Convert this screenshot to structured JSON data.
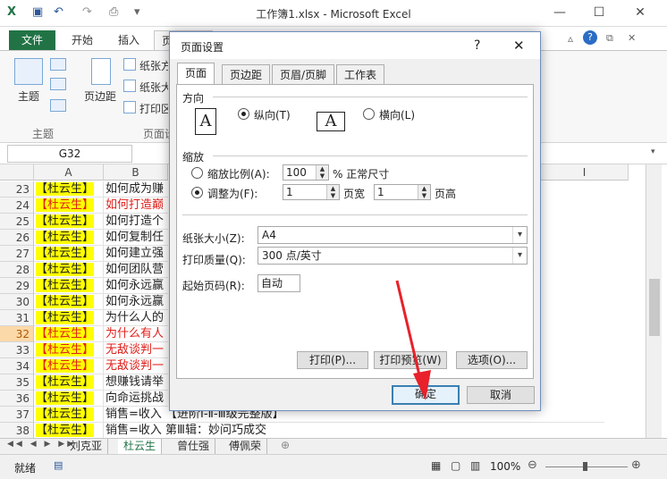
{
  "window": {
    "title": "工作簿1.xlsx - Microsoft Excel",
    "controls": [
      "—",
      "☐",
      "✕"
    ]
  },
  "ribbon": {
    "tabs": [
      "文件",
      "开始",
      "插入",
      "页面布局"
    ],
    "groups": {
      "theme_label": "主题",
      "theme_group": "主题",
      "margins_label": "页边距",
      "orientation_label": "纸张方向",
      "size_label": "纸张大小",
      "print_area_label": "打印区域",
      "page_setup_group": "页面设"
    }
  },
  "formula_bar": {
    "name_box": "G32"
  },
  "grid": {
    "columns": [
      "A",
      "B",
      "I"
    ],
    "rows": [
      {
        "n": "23",
        "a": "【杜云生】",
        "b": "如何成为赚",
        "red": false,
        "sel": false
      },
      {
        "n": "24",
        "a": "【杜云生】",
        "b": "如何打造巅",
        "red": true,
        "sel": false
      },
      {
        "n": "25",
        "a": "【杜云生】",
        "b": "如何打造个",
        "red": false,
        "sel": false
      },
      {
        "n": "26",
        "a": "【杜云生】",
        "b": "如何复制任",
        "red": false,
        "sel": false
      },
      {
        "n": "27",
        "a": "【杜云生】",
        "b": "如何建立强",
        "red": false,
        "sel": false
      },
      {
        "n": "28",
        "a": "【杜云生】",
        "b": "如何团队营",
        "red": false,
        "sel": false
      },
      {
        "n": "29",
        "a": "【杜云生】",
        "b": "如何永远赢",
        "red": false,
        "sel": false
      },
      {
        "n": "30",
        "a": "【杜云生】",
        "b": "如何永远赢",
        "red": false,
        "sel": false
      },
      {
        "n": "31",
        "a": "【杜云生】",
        "b": "为什么人的",
        "red": false,
        "sel": false
      },
      {
        "n": "32",
        "a": "【杜云生】",
        "b": "为什么有人",
        "red": true,
        "sel": true
      },
      {
        "n": "33",
        "a": "【杜云生】",
        "b": "无敌谈判一",
        "red": true,
        "sel": false
      },
      {
        "n": "34",
        "a": "【杜云生】",
        "b": "无敌谈判一",
        "red": true,
        "sel": false
      },
      {
        "n": "35",
        "a": "【杜云生】",
        "b": "想赚钱请举",
        "red": false,
        "sel": false
      },
      {
        "n": "36",
        "a": "【杜云生】",
        "b": "向命运挑战",
        "red": false,
        "sel": false
      },
      {
        "n": "37",
        "a": "【杜云生】",
        "b": "销售=收入 【进阶Ⅰ-Ⅱ-Ⅲ级完整版】",
        "red": false,
        "sel": false
      },
      {
        "n": "38",
        "a": "【杜云生】",
        "b": "销售=收入 第Ⅲ辑：妙问巧成交",
        "red": false,
        "sel": false
      }
    ]
  },
  "sheets": [
    "刘克亚",
    "杜云生",
    "曾仕强",
    "傅佩荣"
  ],
  "status": {
    "ready": "就绪",
    "zoom": "100%"
  },
  "dialog": {
    "title": "页面设置",
    "help": "?",
    "close": "✕",
    "tabs": [
      "页面",
      "页边距",
      "页眉/页脚",
      "工作表"
    ],
    "orientation": {
      "heading": "方向",
      "portrait": "纵向(T)",
      "landscape": "横向(L)",
      "icon_letter": "A"
    },
    "scaling": {
      "heading": "缩放",
      "adjust_label": "缩放比例(A):",
      "adjust_value": "100",
      "normal_size": "% 正常尺寸",
      "fit_label": "调整为(F):",
      "fit_wide": "1",
      "wide_unit": "页宽",
      "fit_tall": "1",
      "tall_unit": "页高"
    },
    "paper_size": {
      "label": "纸张大小(Z):",
      "value": "A4"
    },
    "print_quality": {
      "label": "打印质量(Q):",
      "value": "300 点/英寸"
    },
    "first_page": {
      "label": "起始页码(R):",
      "value": "自动"
    },
    "buttons": {
      "print": "打印(P)...",
      "preview": "打印预览(W)",
      "options": "选项(O)...",
      "ok": "确定",
      "cancel": "取消"
    }
  },
  "colors": {
    "excel_green": "#217346",
    "red_text": "#e0201b",
    "highlight": "#ffff00",
    "annotation_arrow": "#e8212a"
  }
}
